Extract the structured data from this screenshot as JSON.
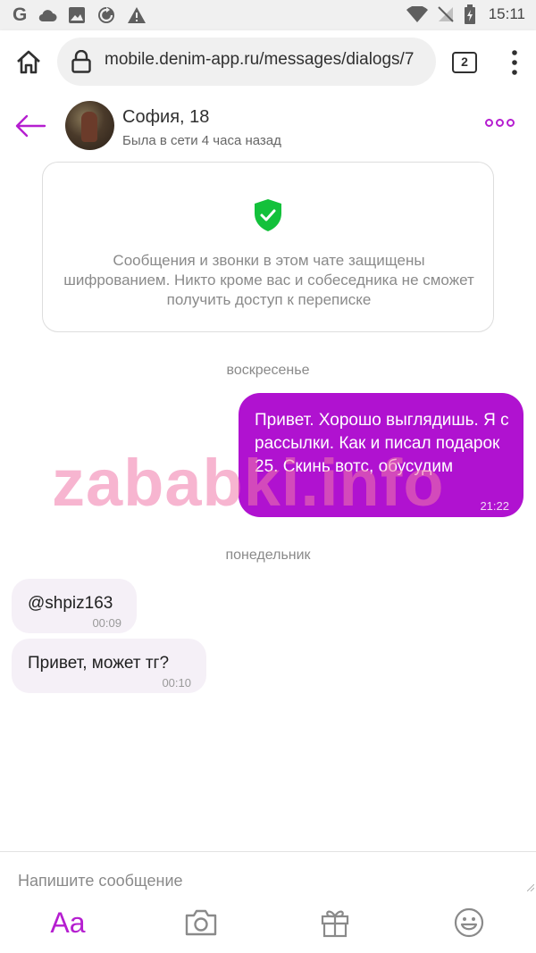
{
  "status_bar": {
    "left_icons": [
      "google-icon",
      "cloud-icon",
      "image-icon",
      "refresh-icon",
      "warning-icon"
    ],
    "right_icons": [
      "wifi-icon",
      "no-sim-icon",
      "battery-icon"
    ],
    "g_letter": "G",
    "time": "15:11"
  },
  "browser": {
    "url": "mobile.denim-app.ru/messages/dialogs/7",
    "tab_count": "2"
  },
  "chat": {
    "contact_name": "София, 18",
    "contact_status": "Была в сети 4 часа назад",
    "accent_color": "#b51ed0"
  },
  "encryption_notice": "Сообщения и звонки в этом чате защищены шифрованием. Никто кроме вас и собеседника не сможет получить доступ к переписке",
  "day_sunday": "воскресенье",
  "day_monday": "понедельник",
  "messages": [
    {
      "direction": "out",
      "text": "Привет. Хорошо выглядишь. Я с рассылки. Как и писал подарок 25. Скинь вотс, обусудим",
      "time": "21:22"
    },
    {
      "direction": "in",
      "text": "@shpiz163",
      "time": "00:09"
    },
    {
      "direction": "in",
      "text": "Привет, может тг?",
      "time": "00:10"
    }
  ],
  "watermark": "zababki.info",
  "compose": {
    "placeholder": "Напишите сообщение"
  },
  "toolbar": {
    "text_format_label": "Aa",
    "icons": [
      "camera-icon",
      "gift-icon",
      "emoji-icon"
    ]
  }
}
